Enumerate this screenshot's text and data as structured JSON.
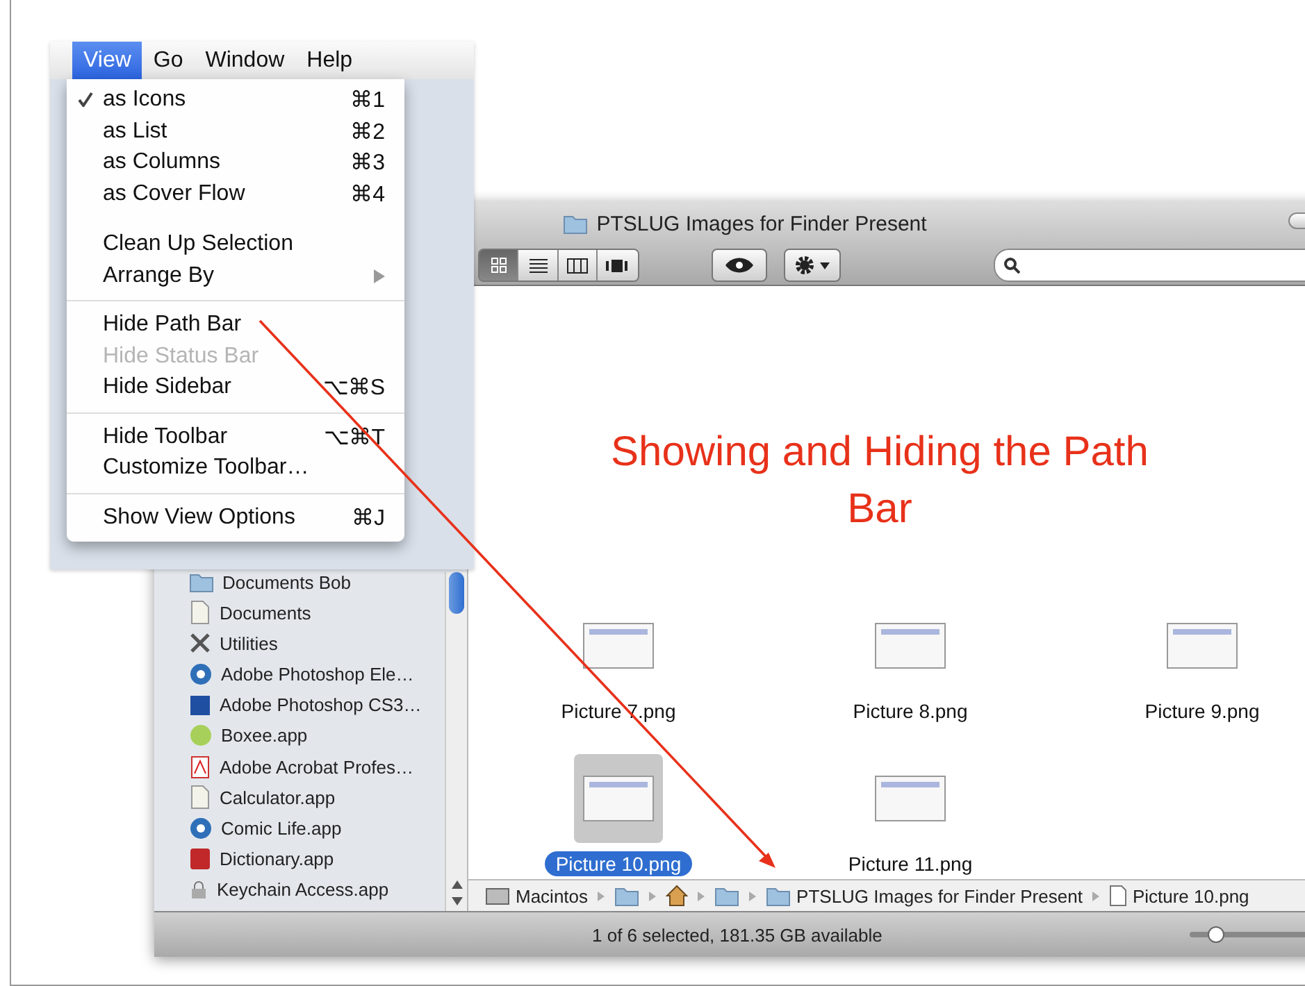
{
  "slide": {
    "title": "Showing and Hiding the Path Bar"
  },
  "menu_bar": [
    {
      "label": "View",
      "selected": true
    },
    {
      "label": "Go",
      "selected": false
    },
    {
      "label": "Window",
      "selected": false
    },
    {
      "label": "Help",
      "selected": false
    }
  ],
  "view_menu": {
    "groups": [
      [
        {
          "label": "as Icons",
          "shortcut": "⌘1",
          "checked": true,
          "disabled": false,
          "submenu": false
        },
        {
          "label": "as List",
          "shortcut": "⌘2",
          "checked": false,
          "disabled": false,
          "submenu": false
        },
        {
          "label": "as Columns",
          "shortcut": "⌘3",
          "checked": false,
          "disabled": false,
          "submenu": false
        },
        {
          "label": "as Cover Flow",
          "shortcut": "⌘4",
          "checked": false,
          "disabled": false,
          "submenu": false
        }
      ],
      [
        {
          "label": "Clean Up Selection",
          "checked": false,
          "disabled": false,
          "submenu": false
        },
        {
          "label": "Arrange By",
          "checked": false,
          "disabled": false,
          "submenu": true
        }
      ],
      [
        {
          "label": "Hide Path Bar",
          "checked": false,
          "disabled": false,
          "submenu": false
        },
        {
          "label": "Hide Status Bar",
          "checked": false,
          "disabled": true,
          "submenu": false
        },
        {
          "label": "Hide Sidebar",
          "shortcut": "⌥⌘S",
          "checked": false,
          "disabled": false,
          "submenu": false
        }
      ],
      [
        {
          "label": "Hide Toolbar",
          "shortcut": "⌥⌘T",
          "checked": false,
          "disabled": false,
          "submenu": false
        },
        {
          "label": "Customize Toolbar…",
          "checked": false,
          "disabled": false,
          "submenu": false
        }
      ],
      [
        {
          "label": "Show View Options",
          "shortcut": "⌘J",
          "checked": false,
          "disabled": false,
          "submenu": false
        }
      ]
    ]
  },
  "window": {
    "title": "PTSLUG Images for Finder Present"
  },
  "view_buttons": [
    {
      "kind": "icons",
      "selected": true
    },
    {
      "kind": "list",
      "selected": false
    },
    {
      "kind": "columns",
      "selected": false
    },
    {
      "kind": "coverflow",
      "selected": false
    }
  ],
  "sidebar": {
    "items": [
      {
        "label": "Documents Bob",
        "kind": "folder"
      },
      {
        "label": "Documents",
        "kind": "document"
      },
      {
        "label": "Utilities",
        "kind": "tools"
      },
      {
        "label": "Adobe Photoshop Ele…",
        "kind": "app-round"
      },
      {
        "label": "Adobe Photoshop CS3…",
        "kind": "app-square"
      },
      {
        "label": "Boxee.app",
        "kind": "app-green"
      },
      {
        "label": "Adobe Acrobat Profes…",
        "kind": "app-red"
      },
      {
        "label": "Calculator.app",
        "kind": "document"
      },
      {
        "label": "Comic Life.app",
        "kind": "app-round"
      },
      {
        "label": "Dictionary.app",
        "kind": "app-square-red"
      },
      {
        "label": "Keychain Access.app",
        "kind": "lock"
      }
    ]
  },
  "files": [
    {
      "name": "Picture 7.png",
      "selected": false
    },
    {
      "name": "Picture 8.png",
      "selected": false
    },
    {
      "name": "Picture 9.png",
      "selected": false
    },
    {
      "name": "Picture 10.png",
      "selected": true
    },
    {
      "name": "Picture 11.png",
      "selected": false
    }
  ],
  "path_bar": [
    {
      "kind": "disk",
      "label": "Macintos"
    },
    {
      "kind": "folder"
    },
    {
      "kind": "home"
    },
    {
      "kind": "folder"
    },
    {
      "kind": "folder",
      "label": "PTSLUG Images for Finder Present"
    },
    {
      "kind": "file",
      "label": "Picture 10.png"
    }
  ],
  "status_bar": {
    "text": "1 of 6 selected, 181.35 GB available",
    "icon_size": {
      "level": 0.2
    }
  }
}
